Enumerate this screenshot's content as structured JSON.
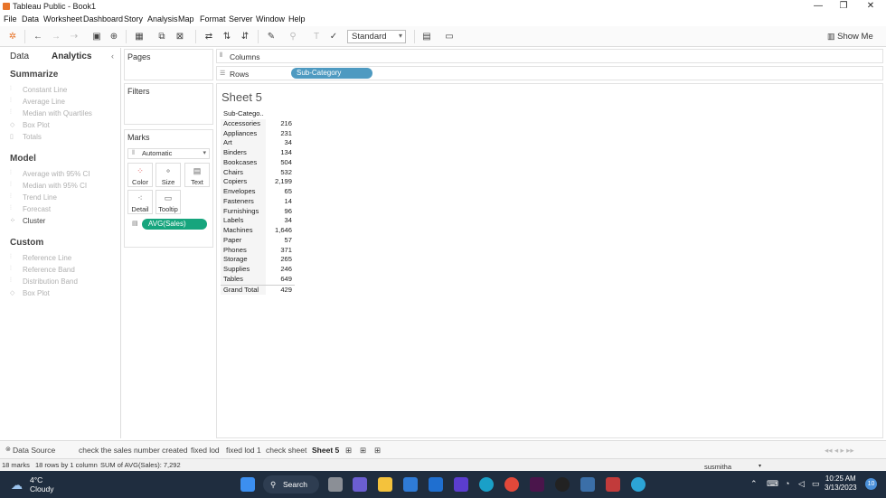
{
  "window": {
    "title": "Tableau Public - Book1"
  },
  "menu": [
    "File",
    "Data",
    "Worksheet",
    "Dashboard",
    "Story",
    "Analysis",
    "Map",
    "Format",
    "Server",
    "Window",
    "Help"
  ],
  "toolbar": {
    "fit": "Standard",
    "show_me": "Show Me"
  },
  "left": {
    "tabs": [
      "Data",
      "Analytics"
    ],
    "summarize": {
      "title": "Summarize",
      "items": [
        "Constant Line",
        "Average Line",
        "Median with Quartiles",
        "Box Plot",
        "Totals"
      ]
    },
    "model": {
      "title": "Model",
      "items": [
        "Average with 95% CI",
        "Median with 95% CI",
        "Trend Line",
        "Forecast",
        "Cluster"
      ]
    },
    "custom": {
      "title": "Custom",
      "items": [
        "Reference Line",
        "Reference Band",
        "Distribution Band",
        "Box Plot"
      ]
    }
  },
  "cards": {
    "pages": "Pages",
    "filters": "Filters",
    "marks": "Marks",
    "mark_type": "Automatic",
    "buttons": [
      "Color",
      "Size",
      "Text",
      "Detail",
      "Tooltip"
    ],
    "measure_pill": "AVG(Sales)"
  },
  "shelves": {
    "columns": "Columns",
    "rows": "Rows",
    "rows_pill": "Sub-Category"
  },
  "sheet": {
    "title": "Sheet 5",
    "header": "Sub-Catego..",
    "rows": [
      {
        "c": "Accessories",
        "v": "216"
      },
      {
        "c": "Appliances",
        "v": "231"
      },
      {
        "c": "Art",
        "v": "34"
      },
      {
        "c": "Binders",
        "v": "134"
      },
      {
        "c": "Bookcases",
        "v": "504"
      },
      {
        "c": "Chairs",
        "v": "532"
      },
      {
        "c": "Copiers",
        "v": "2,199"
      },
      {
        "c": "Envelopes",
        "v": "65"
      },
      {
        "c": "Fasteners",
        "v": "14"
      },
      {
        "c": "Furnishings",
        "v": "96"
      },
      {
        "c": "Labels",
        "v": "34"
      },
      {
        "c": "Machines",
        "v": "1,646"
      },
      {
        "c": "Paper",
        "v": "57"
      },
      {
        "c": "Phones",
        "v": "371"
      },
      {
        "c": "Storage",
        "v": "265"
      },
      {
        "c": "Supplies",
        "v": "246"
      },
      {
        "c": "Tables",
        "v": "649"
      }
    ],
    "total": {
      "c": "Grand Total",
      "v": "429"
    }
  },
  "tabs": [
    "Data Source",
    "check the sales number created",
    "fixed lod",
    "fixed lod 1",
    "check sheet",
    "Sheet 5"
  ],
  "status": {
    "marks": "18 marks",
    "dims": "18 rows by 1 column",
    "sum": "SUM of AVG(Sales): 7,292",
    "user": "susmitha"
  },
  "taskbar": {
    "temp": "4°C",
    "weather": "Cloudy",
    "search": "Search",
    "time": "10:25 AM",
    "date": "3/13/2023",
    "badge": "10"
  }
}
